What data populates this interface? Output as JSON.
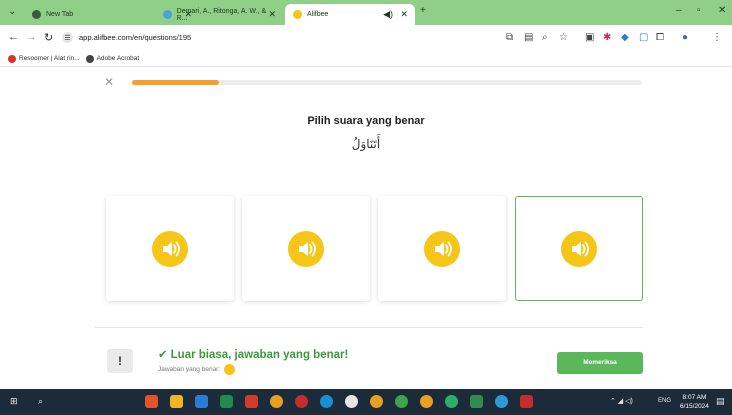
{
  "browser": {
    "tabs": [
      {
        "label": "New Tab",
        "active": false
      },
      {
        "label": "Demari, A., Ritonga, A. W., & R...",
        "active": false
      },
      {
        "label": "Alifbee",
        "active": true
      }
    ],
    "url": "app.alifbee.com/en/questions/195",
    "bookmarks": [
      "Resoomer | Alat rin...",
      "Adobe Acrobat"
    ]
  },
  "question": {
    "progress": 0.17,
    "title": "Pilih suara yang benar",
    "arabic_word": "أَتَنَاوَلُ",
    "options_count": 4,
    "selected_index": 3
  },
  "feedback": {
    "title": "Luar biasa, jawaban yang benar!",
    "subtitle": "Jawaban yang benar:",
    "button_label": "Memeriksa",
    "warn_glyph": "!"
  },
  "taskbar": {
    "lang": "ENG",
    "time": "8:07 AM",
    "date": "6/15/2024"
  },
  "colors": {
    "accent": "#5ab85a",
    "speaker": "#f5c518",
    "progress": "#f5a028",
    "chrome_tab": "#8fcf87"
  }
}
